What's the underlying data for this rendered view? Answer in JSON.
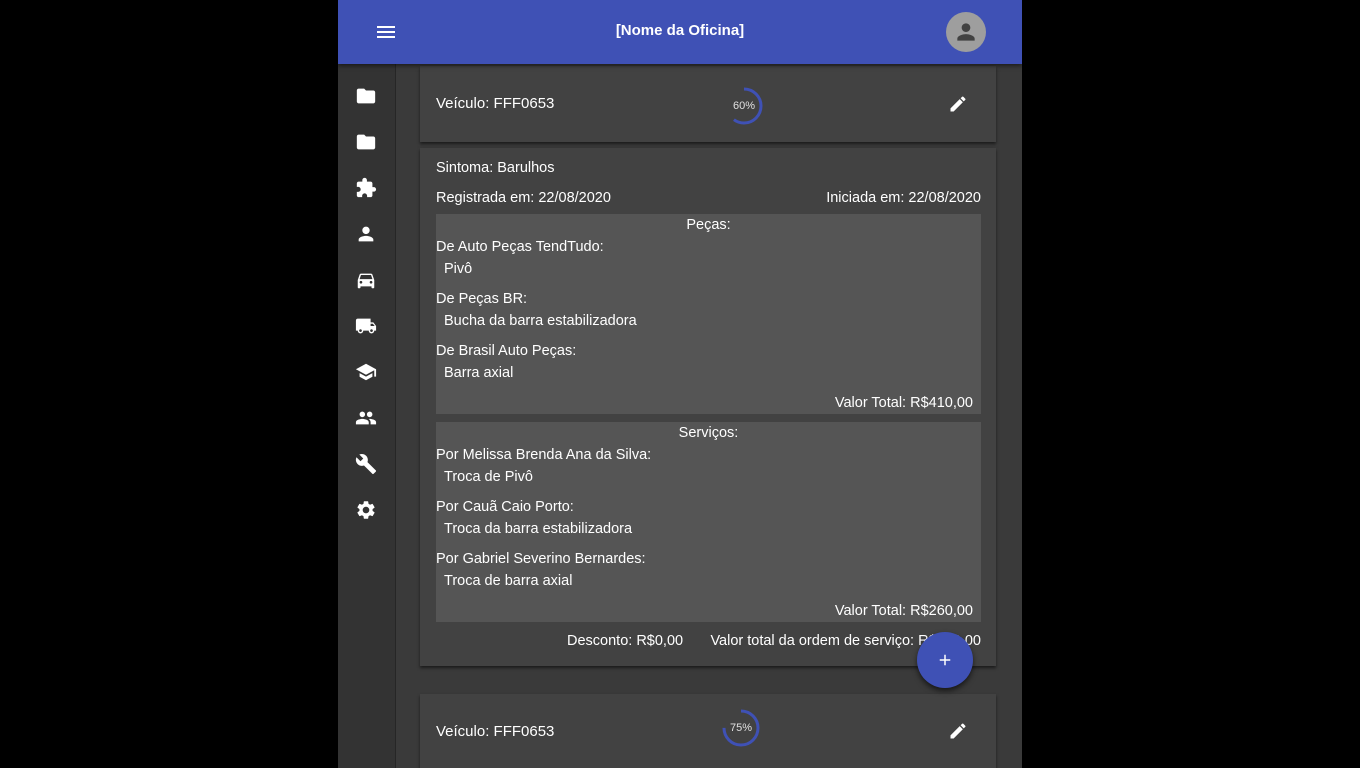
{
  "app": {
    "title": "[Nome da Oficina]"
  },
  "colors": {
    "primary": "#3f51b5",
    "progress": "#3f51b5",
    "background": "#333333",
    "card": "#424242",
    "panel": "#555555"
  },
  "sidebar": {
    "items": [
      {
        "icon": "folder-icon"
      },
      {
        "icon": "folder-icon"
      },
      {
        "icon": "puzzle-icon"
      },
      {
        "icon": "person-icon"
      },
      {
        "icon": "car-icon"
      },
      {
        "icon": "truck-icon"
      },
      {
        "icon": "school-icon"
      },
      {
        "icon": "people-icon"
      },
      {
        "icon": "wrench-icon"
      },
      {
        "icon": "gear-icon"
      }
    ]
  },
  "orders": [
    {
      "vehicle": "Veículo: FFF0653",
      "progress_label": "60%",
      "progress_value": 0.6,
      "symptom": "Sintoma: Barulhos",
      "registered": "Registrada em: 22/08/2020",
      "started": "Iniciada em: 22/08/2020",
      "parts": {
        "title": "Peças:",
        "groups": [
          {
            "supplier": "De Auto Peças TendTudo:",
            "item": "Pivô"
          },
          {
            "supplier": "De Peças BR:",
            "item": "Bucha da barra estabilizadora"
          },
          {
            "supplier": "De Brasil Auto Peças:",
            "item": "Barra axial"
          }
        ],
        "total": "Valor Total: R$410,00"
      },
      "services": {
        "title": "Serviços:",
        "groups": [
          {
            "provider": "Por Melissa Brenda Ana da Silva:",
            "item": "Troca de Pivô"
          },
          {
            "provider": "Por Cauã Caio Porto:",
            "item": "Troca da barra estabilizadora"
          },
          {
            "provider": "Por Gabriel Severino Bernardes:",
            "item": "Troca de barra axial"
          }
        ],
        "total": "Valor Total: R$260,00"
      },
      "discount": "Desconto: R$0,00",
      "order_total": "Valor total da ordem de serviço: R$670,00"
    },
    {
      "vehicle": "Veículo: FFF0653",
      "progress_label": "75%",
      "progress_value": 0.75
    }
  ],
  "fab": {
    "icon": "plus-icon"
  }
}
